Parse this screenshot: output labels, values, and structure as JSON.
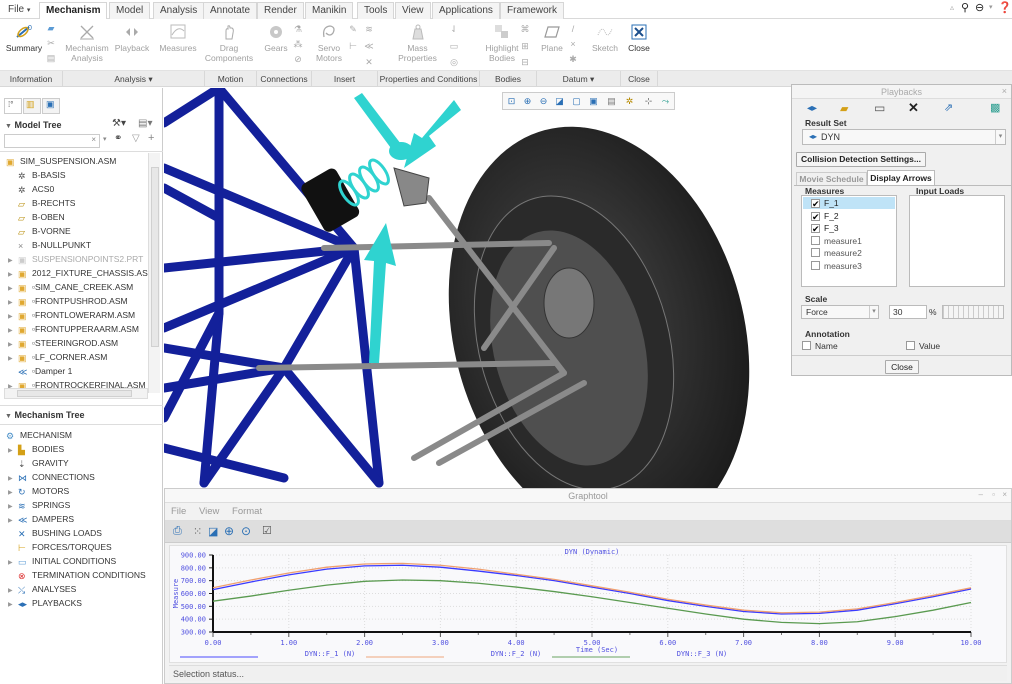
{
  "menu_tabs": [
    {
      "label": "File",
      "dropdown": true
    },
    {
      "label": "Mechanism",
      "active": true
    },
    {
      "label": "Model"
    },
    {
      "label": "Analysis"
    },
    {
      "label": "Annotate"
    },
    {
      "label": "Render"
    },
    {
      "label": "Manikin"
    },
    {
      "label": "Tools"
    },
    {
      "label": "View"
    },
    {
      "label": "Applications"
    },
    {
      "label": "Framework"
    }
  ],
  "top_right_icons": [
    "collapse-ribbon-icon",
    "search-icon",
    "community-icon",
    "help-icon"
  ],
  "ribbon": {
    "buttons": {
      "summary": "Summary",
      "mechanism_analysis": "Mechanism Analysis",
      "playback": "Playback",
      "measures": "Measures",
      "drag_components": "Drag Components",
      "gears": "Gears",
      "servo_motors": "Servo Motors",
      "mass_properties": "Mass Properties",
      "highlight_bodies": "Highlight Bodies",
      "plane": "Plane",
      "sketch": "Sketch",
      "close": "Close"
    },
    "groups": [
      "Information",
      "Analysis ▾",
      "Motion",
      "Connections",
      "Insert",
      "Properties and Conditions",
      "Bodies",
      "Datum ▾",
      "Close"
    ]
  },
  "model_tree": {
    "title": "Model Tree",
    "search_placeholder": "",
    "items": [
      {
        "label": "SIM_SUSPENSION.ASM",
        "level": 0,
        "icon": "assembly-icon"
      },
      {
        "label": "B-BASIS",
        "level": 1,
        "icon": "coordinate-system-icon"
      },
      {
        "label": "ACS0",
        "level": 1,
        "icon": "coordinate-system-icon"
      },
      {
        "label": "B-RECHTS",
        "level": 1,
        "icon": "datum-plane-icon"
      },
      {
        "label": "B-OBEN",
        "level": 1,
        "icon": "datum-plane-icon"
      },
      {
        "label": "B-VORNE",
        "level": 1,
        "icon": "datum-plane-icon"
      },
      {
        "label": "B-NULLPUNKT",
        "level": 1,
        "icon": "datum-point-icon"
      },
      {
        "label": "SUSPENSIONPOINTS2.PRT",
        "level": 1,
        "icon": "part-icon",
        "expand": true,
        "dim": true
      },
      {
        "label": "2012_FIXTURE_CHASSIS.ASM",
        "level": 1,
        "icon": "assembly-icon",
        "expand": true
      },
      {
        "label": "▫SIM_CANE_CREEK.ASM",
        "level": 1,
        "icon": "assembly-icon",
        "expand": true
      },
      {
        "label": "▫FRONTPUSHROD.ASM",
        "level": 1,
        "icon": "assembly-icon",
        "expand": true
      },
      {
        "label": "▫FRONTLOWERARM.ASM",
        "level": 1,
        "icon": "assembly-icon",
        "expand": true
      },
      {
        "label": "▫FRONTUPPERAARM.ASM",
        "level": 1,
        "icon": "assembly-icon",
        "expand": true
      },
      {
        "label": "▫STEERINGROD.ASM",
        "level": 1,
        "icon": "assembly-icon",
        "expand": true
      },
      {
        "label": "▫LF_CORNER.ASM",
        "level": 1,
        "icon": "assembly-icon",
        "expand": true
      },
      {
        "label": "▫Damper 1",
        "level": 1,
        "icon": "damper-icon"
      },
      {
        "label": "▫FRONTROCKERFINAL.ASM",
        "level": 1,
        "icon": "assembly-icon",
        "expand": true
      }
    ]
  },
  "mechanism_tree": {
    "title": "Mechanism Tree",
    "items": [
      {
        "label": "MECHANISM",
        "icon": "mechanism-icon",
        "expand": false,
        "root": true
      },
      {
        "label": "BODIES",
        "icon": "bodies-icon",
        "expand": true
      },
      {
        "label": "GRAVITY",
        "icon": "gravity-icon",
        "expand": false
      },
      {
        "label": "CONNECTIONS",
        "icon": "connections-icon",
        "expand": true
      },
      {
        "label": "MOTORS",
        "icon": "motors-icon",
        "expand": true
      },
      {
        "label": "SPRINGS",
        "icon": "springs-icon",
        "expand": true
      },
      {
        "label": "DAMPERS",
        "icon": "dampers-icon",
        "expand": true
      },
      {
        "label": "BUSHING LOADS",
        "icon": "bushing-icon",
        "expand": false
      },
      {
        "label": "FORCES/TORQUES",
        "icon": "forces-icon",
        "expand": false
      },
      {
        "label": "INITIAL CONDITIONS",
        "icon": "initial-conditions-icon",
        "expand": true
      },
      {
        "label": "TERMINATION CONDITIONS",
        "icon": "termination-icon",
        "expand": false
      },
      {
        "label": "ANALYSES",
        "icon": "analyses-icon",
        "expand": true
      },
      {
        "label": "PLAYBACKS",
        "icon": "playbacks-icon",
        "expand": true
      }
    ]
  },
  "view_toolbar": [
    "refit-icon",
    "zoom-in-icon",
    "zoom-out-icon",
    "repaint-icon",
    "display-style-icon",
    "saved-orientations-icon",
    "view-manager-icon",
    "datum-display-icon",
    "spin-center-icon",
    "annotation-display-icon"
  ],
  "playbacks": {
    "title": "Playbacks",
    "result_set_label": "Result Set",
    "result_set_value": "DYN",
    "collision_button": "Collision Detection Settings...",
    "tabs": [
      "Movie Schedule",
      "Display Arrows"
    ],
    "active_tab": "Display Arrows",
    "measures_label": "Measures",
    "input_loads_label": "Input Loads",
    "measures": [
      {
        "label": "F_1",
        "checked": true,
        "selected": true
      },
      {
        "label": "F_2",
        "checked": true
      },
      {
        "label": "F_3",
        "checked": true
      },
      {
        "label": "measure1",
        "checked": false
      },
      {
        "label": "measure2",
        "checked": false
      },
      {
        "label": "measure3",
        "checked": false
      }
    ],
    "scale_label": "Scale",
    "scale_type": "Force",
    "scale_value": "30",
    "scale_unit": "%",
    "annotation_label": "Annotation",
    "annotation_name": "Name",
    "annotation_value": "Value",
    "close_button": "Close"
  },
  "graphtool": {
    "title": "Graphtool",
    "menu": [
      "File",
      "View",
      "Format"
    ],
    "status": "Selection status..."
  },
  "chart_data": {
    "type": "line",
    "title": "DYN (Dynamic)",
    "xlabel": "Time (Sec)",
    "ylabel": "Measure",
    "xlim": [
      0,
      10
    ],
    "ylim": [
      300,
      900
    ],
    "x_ticks": [
      "0.00",
      "1.00",
      "2.00",
      "3.00",
      "4.00",
      "5.00",
      "6.00",
      "7.00",
      "8.00",
      "9.00",
      "10.00"
    ],
    "y_ticks": [
      "300.00",
      "400.00",
      "500.00",
      "600.00",
      "700.00",
      "800.00",
      "900.00"
    ],
    "grid": true,
    "legend_position": "bottom",
    "x": [
      0,
      0.5,
      1,
      1.5,
      2,
      2.5,
      3,
      3.5,
      4,
      4.5,
      5,
      5.5,
      6,
      6.5,
      7,
      7.5,
      8,
      8.5,
      9,
      9.5,
      10
    ],
    "series": [
      {
        "name": "DYN::F_1 (N)",
        "color": "#3a3aff",
        "values": [
          630,
          690,
          745,
          790,
          815,
          820,
          805,
          775,
          740,
          700,
          650,
          600,
          545,
          500,
          460,
          440,
          445,
          470,
          520,
          575,
          635
        ]
      },
      {
        "name": "DYN::F_2 (N)",
        "color": "#f0a070",
        "values": [
          645,
          705,
          760,
          805,
          830,
          835,
          820,
          790,
          750,
          710,
          660,
          610,
          555,
          510,
          470,
          450,
          455,
          480,
          530,
          585,
          645
        ]
      },
      {
        "name": "DYN::F_3 (N)",
        "color": "#5a9a50",
        "values": [
          540,
          580,
          625,
          665,
          695,
          705,
          700,
          680,
          650,
          615,
          575,
          530,
          485,
          440,
          400,
          375,
          365,
          380,
          420,
          470,
          530
        ]
      }
    ]
  }
}
